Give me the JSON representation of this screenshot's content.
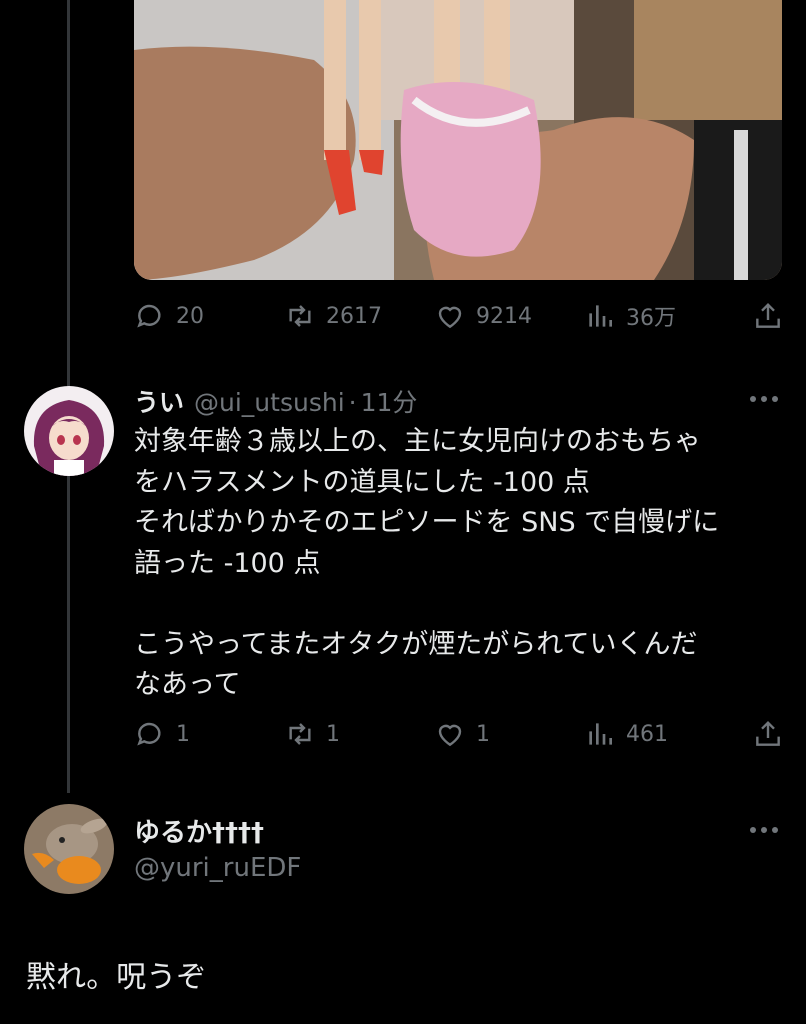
{
  "tweet1": {
    "stats": {
      "replies": "20",
      "retweets": "2617",
      "likes": "9214",
      "views": "36万"
    }
  },
  "tweet2": {
    "name": "うい",
    "handle": "@ui_utsushi",
    "separator": "·",
    "time": "11分",
    "body": "対象年齢３歳以上の、主に女児向けのおもちゃ\nをハラスメントの道具にした -100 点\nそればかりかそのエピソードを SNS で自慢げに\n語った -100 点\n\nこうやってまたオタクが煙たがられていくんだ\nなあって",
    "stats": {
      "replies": "1",
      "retweets": "1",
      "likes": "1",
      "views": "461"
    }
  },
  "tweet3": {
    "name": "ゆるか",
    "name_suffix": "††††",
    "handle": "@yuri_ruEDF",
    "body": "黙れ。呪うぞ"
  },
  "icons": {
    "reply": "reply-icon",
    "retweet": "retweet-icon",
    "like": "heart-icon",
    "views": "views-icon",
    "share": "share-icon",
    "more": "more-icon"
  },
  "colors": {
    "background": "#000000",
    "text": "#e7e9ea",
    "muted": "#71767b",
    "thread_line": "#333639"
  }
}
